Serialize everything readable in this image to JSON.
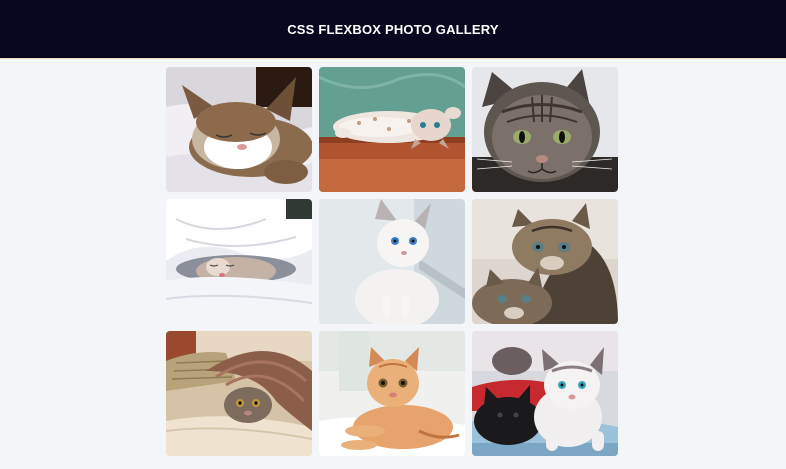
{
  "header": {
    "title": "CSS FLEXBOX PHOTO GALLERY",
    "background": "#070720"
  },
  "gallery": {
    "photos": [
      {
        "subject": "sleeping tabby-white kitten on white blanket"
      },
      {
        "subject": "spotted kitten lying upside down on wooden floor against teal wall"
      },
      {
        "subject": "gray tabby cat portrait"
      },
      {
        "subject": "kitten sleeping under white duvet"
      },
      {
        "subject": "white siamese kitten with blue eyes"
      },
      {
        "subject": "two tabby kittens"
      },
      {
        "subject": "tabby kitten hiding under a rug"
      },
      {
        "subject": "orange tabby kitten lying down"
      },
      {
        "subject": "black kitten and white kitten with blue eyes"
      }
    ]
  }
}
